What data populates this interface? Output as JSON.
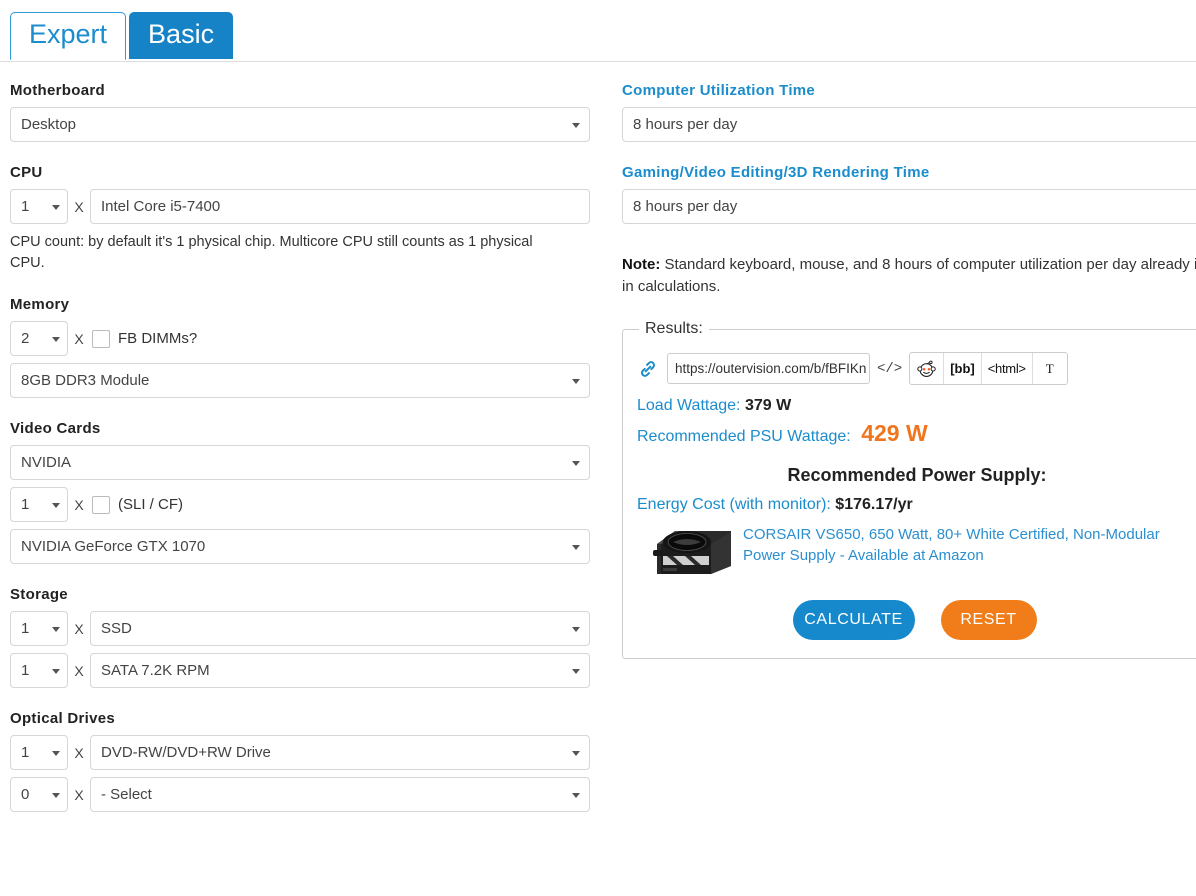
{
  "tabs": [
    {
      "label": "Expert",
      "active": true
    },
    {
      "label": "Basic",
      "active": false
    }
  ],
  "colors": {
    "accent_blue": "#1b8ccc",
    "tab_blue": "#1683c6",
    "orange": "#f0761e",
    "reset_orange": "#f07d1a",
    "link_blue": "#2b8fd0"
  },
  "left": {
    "motherboard": {
      "label": "Motherboard",
      "value": "Desktop"
    },
    "cpu": {
      "label": "CPU",
      "count": "1",
      "multiplier": "X",
      "value": "Intel Core i5-7400",
      "help": "CPU count: by default it's 1 physical chip. Multicore CPU still counts as 1 physical CPU."
    },
    "memory": {
      "label": "Memory",
      "count": "2",
      "multiplier": "X",
      "fb_dimms_label": "FB DIMMs?",
      "fb_dimms_checked": false,
      "value": "8GB DDR3 Module"
    },
    "video_cards": {
      "label": "Video Cards",
      "brand": "NVIDIA",
      "count": "1",
      "multiplier": "X",
      "sli_label": "(SLI / CF)",
      "sli_checked": false,
      "model": "NVIDIA GeForce GTX 1070"
    },
    "storage": {
      "label": "Storage",
      "rows": [
        {
          "count": "1",
          "multiplier": "X",
          "value": "SSD"
        },
        {
          "count": "1",
          "multiplier": "X",
          "value": "SATA 7.2K RPM"
        }
      ]
    },
    "optical_drives": {
      "label": "Optical Drives",
      "rows": [
        {
          "count": "1",
          "multiplier": "X",
          "value": "DVD-RW/DVD+RW Drive"
        },
        {
          "count": "0",
          "multiplier": "X",
          "value": "- Select"
        }
      ]
    }
  },
  "right": {
    "utilization": {
      "label": "Computer Utilization Time",
      "value": "8 hours per day"
    },
    "gaming": {
      "label": "Gaming/Video Editing/3D Rendering Time",
      "value": "8 hours per day"
    },
    "note_prefix": "Note:",
    "note_text": " Standard keyboard, mouse, and 8 hours of computer utilization per day already included in calculations.",
    "results": {
      "legend": "Results:",
      "share_url": "https://outervision.com/b/fBFIKn",
      "share_buttons": {
        "code": "</>",
        "reddit": "reddit-icon",
        "bb": "[bb]",
        "html": "<html>",
        "text": "T"
      },
      "load_wattage_label": "Load Wattage:",
      "load_wattage_value": "379 W",
      "recommended_psu_label": "Recommended PSU Wattage:",
      "recommended_psu_value": "429 W",
      "recommended_title": "Recommended Power Supply:",
      "energy_cost_label": "Energy Cost (with monitor):",
      "energy_cost_value": "$176.17/yr",
      "product_text": "CORSAIR VS650, 650 Watt, 80+ White Certified, Non-Modular Power Supply - Available at Amazon",
      "calculate_label": "CALCULATE",
      "reset_label": "RESET"
    }
  }
}
